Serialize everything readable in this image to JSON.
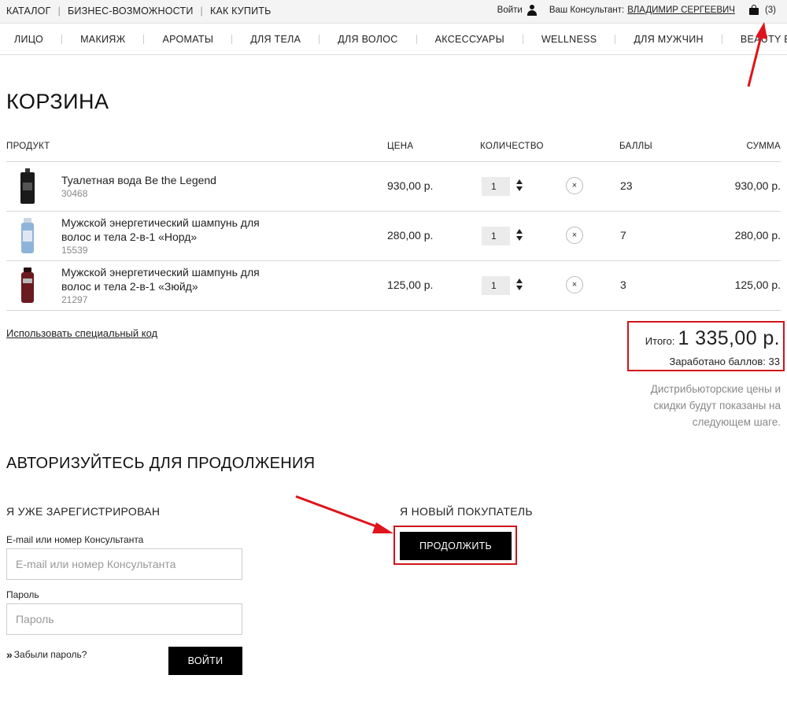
{
  "topbar": {
    "links": [
      "КАТАЛОГ",
      "БИЗНЕС-ВОЗМОЖНОСТИ",
      "КАК КУПИТЬ"
    ],
    "login_label": "Войти",
    "consultant_prefix": "Ваш Консультант:",
    "consultant_name": "ВЛАДИМИР СЕРГЕЕВИЧ",
    "cart_count": "(3)"
  },
  "mainnav": [
    "ЛИЦО",
    "МАКИЯЖ",
    "АРОМАТЫ",
    "ДЛЯ ТЕЛА",
    "ДЛЯ ВОЛОС",
    "АКСЕССУАРЫ",
    "WELLNESS",
    "ДЛЯ МУЖЧИН",
    "BEAUTY EDIT"
  ],
  "page_title": "КОРЗИНА",
  "cart": {
    "headers": {
      "product": "ПРОДУКТ",
      "price": "ЦЕНА",
      "quantity": "КОЛИЧЕСТВО",
      "points": "БАЛЛЫ",
      "sum": "СУММА"
    },
    "items": [
      {
        "name": "Туалетная вода Be the Legend",
        "code": "30468",
        "price": "930,00 р.",
        "qty": "1",
        "points": "23",
        "sum": "930,00 р.",
        "thumb_color": "#1a1a1a"
      },
      {
        "name": "Мужской энергетический шампунь для волос и тела 2-в-1 «Норд»",
        "code": "15539",
        "price": "280,00 р.",
        "qty": "1",
        "points": "7",
        "sum": "280,00 р.",
        "thumb_color": "#8fb4d9"
      },
      {
        "name": "Мужской энергетический шампунь для волос и тела 2-в-1 «Зюйд»",
        "code": "21297",
        "price": "125,00 р.",
        "qty": "1",
        "points": "3",
        "sum": "125,00 р.",
        "thumb_color": "#6b1a1f"
      }
    ],
    "remove_glyph": "×"
  },
  "promo_link": "Использовать специальный код",
  "totals": {
    "total_label": "Итого:",
    "total_value": "1 335,00 р.",
    "earned": "Заработано баллов: 33"
  },
  "distrib_note": "Дистрибьюторские цены и скидки будут показаны на следующем шаге.",
  "auth": {
    "title": "АВТОРИЗУЙТЕСЬ ДЛЯ ПРОДОЛЖЕНИЯ",
    "registered_title": "Я УЖЕ ЗАРЕГИСТРИРОВАН",
    "email_label": "E-mail или номер Консультанта",
    "email_placeholder": "E-mail или номер Консультанта",
    "password_label": "Пароль",
    "password_placeholder": "Пароль",
    "forgot": "Забыли пароль?",
    "login_button": "ВОЙТИ",
    "new_title": "Я НОВЫЙ ПОКУПАТЕЛЬ",
    "continue_button": "ПРОДОЛЖИТЬ"
  },
  "colors": {
    "highlight": "#d0141a",
    "button_bg": "#000000",
    "muted": "#888888"
  },
  "icons": [
    "user-icon",
    "bag-icon",
    "remove-icon",
    "chevron-right-icon",
    "arrow-annotation"
  ]
}
